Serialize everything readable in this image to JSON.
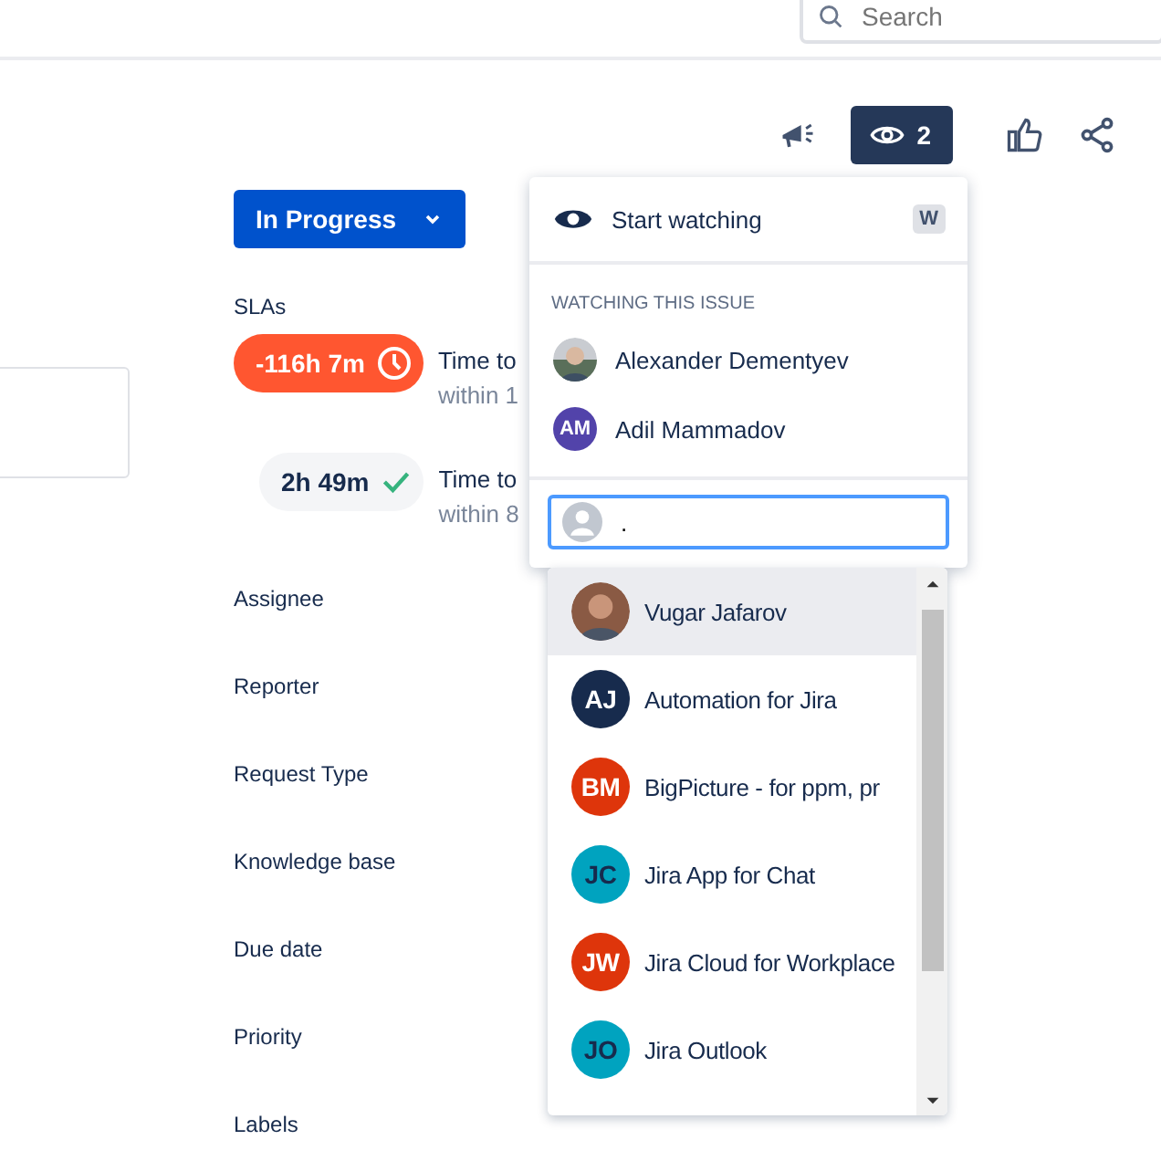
{
  "search": {
    "placeholder": "Search"
  },
  "toolbar": {
    "watch_count": "2",
    "watching_active": true
  },
  "status": {
    "label": "In Progress"
  },
  "slas": {
    "title": "SLAs",
    "items": [
      {
        "time": "-116h 7m",
        "kind": "breached",
        "name": "Time to",
        "target": "within 1"
      },
      {
        "time": "2h 49m",
        "kind": "met",
        "name": "Time to",
        "target": "within 8"
      }
    ]
  },
  "fields": [
    "Assignee",
    "Reporter",
    "Request Type",
    "Knowledge base",
    "Due date",
    "Priority",
    "Labels"
  ],
  "watch_popup": {
    "action": "Start watching",
    "shortcut": "W",
    "section_title": "WATCHING THIS ISSUE",
    "watchers": [
      {
        "name": "Alexander Dementyev"
      },
      {
        "name": "Adil Mammadov",
        "kind": "initials",
        "initials": "AM",
        "color": "#5243aa"
      }
    ],
    "input_value": "."
  },
  "suggestions": [
    {
      "name": "Vugar Jafarov",
      "selected": true
    },
    {
      "name": "Automation for Jira",
      "kind": "initials",
      "initials": "AJ",
      "color": "#172b4d",
      "selected": false
    },
    {
      "name": "BigPicture - for ppm, pr",
      "kind": "initials",
      "initials": "BM",
      "color": "#de350b",
      "selected": false
    },
    {
      "name": "Jira App for Chat",
      "kind": "initials",
      "initials": "JC",
      "color": "#00a3bf",
      "selected": false
    },
    {
      "name": "Jira Cloud for Workplace",
      "kind": "initials",
      "initials": "JW",
      "color": "#de350b",
      "selected": false
    },
    {
      "name": "Jira Outlook",
      "kind": "initials",
      "initials": "JO",
      "color": "#00a3bf",
      "selected": false
    }
  ]
}
